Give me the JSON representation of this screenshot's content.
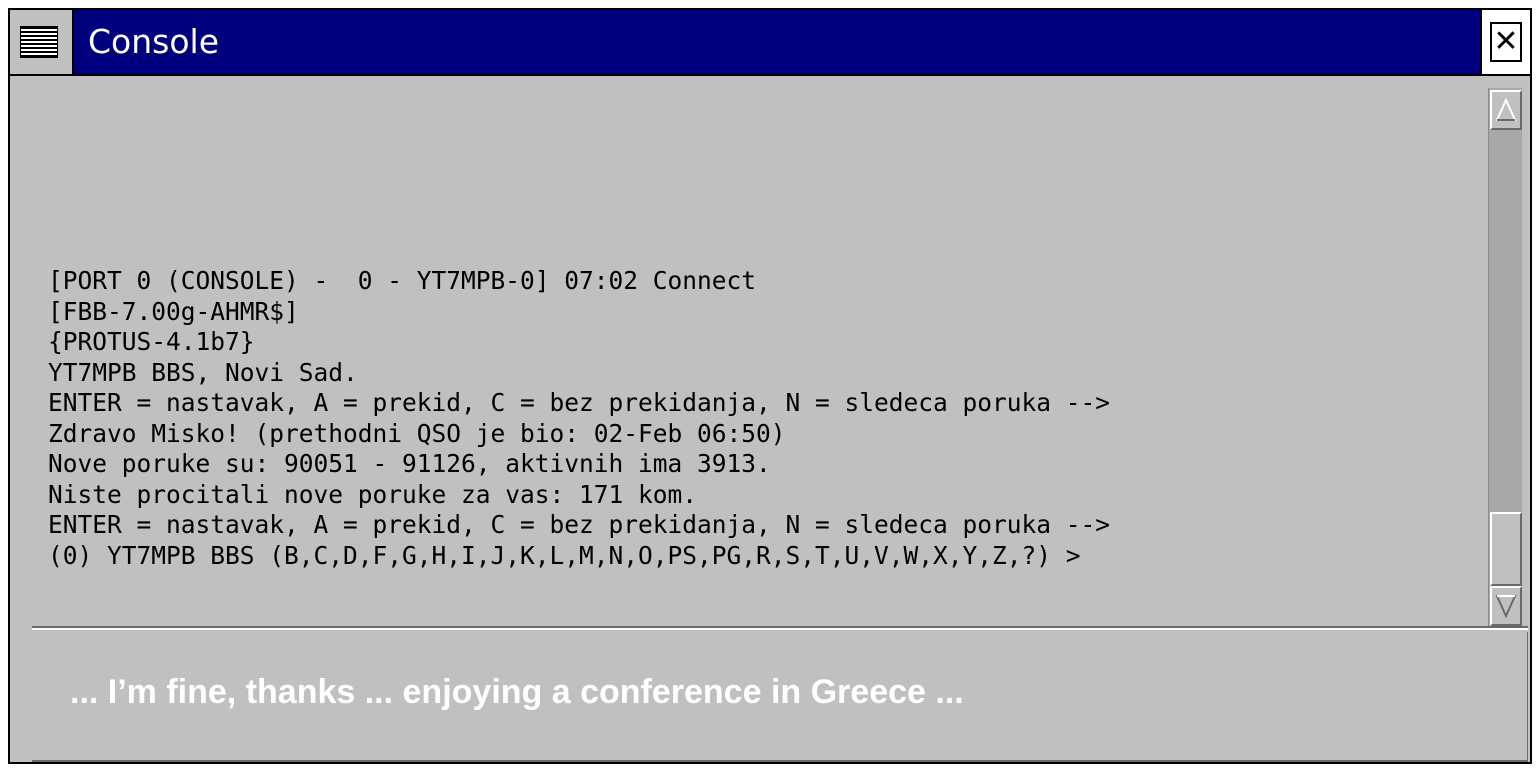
{
  "window": {
    "title": "Console",
    "menu_icon": "window-menu-icon",
    "close_icon": "close-icon",
    "close_glyph": "✕"
  },
  "console": {
    "lines": [
      "[PORT 0 (CONSOLE) -  0 - YT7MPB-0] 07:02 Connect",
      "[FBB-7.00g-AHMR$]",
      "{PROTUS-4.1b7}",
      "YT7MPB BBS, Novi Sad.",
      "ENTER = nastavak, A = prekid, C = bez prekidanja, N = sledeca poruka -->",
      "Zdravo Misko! (prethodni QSO je bio: 02-Feb 06:50)",
      "Nove poruke su: 90051 - 91126, aktivnih ima 3913.",
      "Niste procitali nove poruke za vas: 171 kom.",
      "ENTER = nastavak, A = prekid, C = bez prekidanja, N = sledeca poruka -->",
      "(0) YT7MPB BBS (B,C,D,F,G,H,I,J,K,L,M,N,O,PS,PG,R,S,T,U,V,W,X,Y,Z,?) >"
    ]
  },
  "scrollbar": {
    "up_icon": "scroll-up-arrow-icon",
    "down_icon": "scroll-down-arrow-icon"
  },
  "input": {
    "value": "... I’m fine, thanks ... enjoying a conference in Greece ..."
  },
  "colors": {
    "titlebar": "#00007f",
    "window_bg": "#c0c0c0",
    "scroll_track": "#a8a8a8",
    "input_text": "#ffffff"
  }
}
